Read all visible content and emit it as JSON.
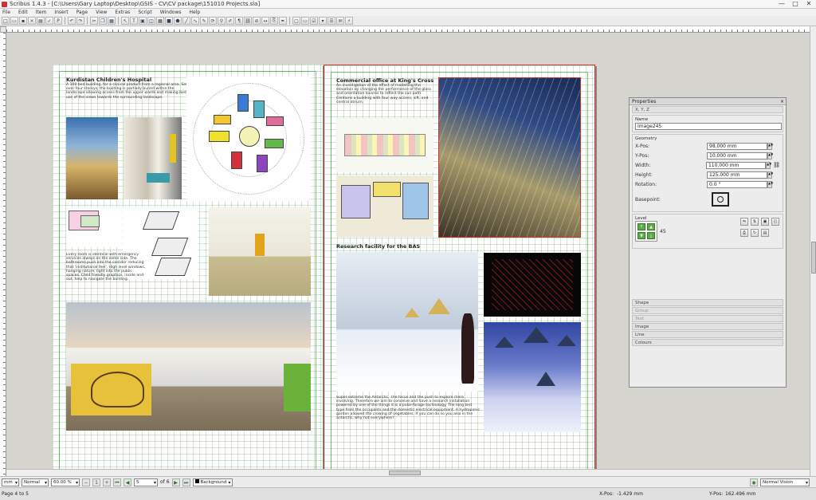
{
  "window": {
    "title": "Scribus 1.4.3 - [C:\\Users\\Gary Laptop\\Desktop\\GSIS - CV\\CV package\\151010 Projects.sla]",
    "buttons": [
      "—",
      "□",
      "✕"
    ]
  },
  "menu": [
    "File",
    "Edit",
    "Item",
    "Insert",
    "Page",
    "View",
    "Extras",
    "Script",
    "Windows",
    "Help"
  ],
  "page_left": {
    "project1": {
      "title": "Kurdistan Children's Hospital",
      "text": "A 100 bed building, for a clinical product from a regional area. Set over four storeys, the building is partially buried within the landscape allowing access from the upper wards and making best use of the views towards the surrounding landscape."
    },
    "project1_caption": "Every room is identical with emergency services always on the same side. The bathrooms push into the corridor reducing that 'institutional feel'. High level windows, hanging nature; light into the public spaces. Child friendly graphics, inside and out, help to navigate the building."
  },
  "page_right": {
    "project2": {
      "title": "Commercial office at King's Cross",
      "text": "An investigation of the effect of modelling the elevation by changing the performance of the glass and orientation louvres to reflect the sun path. Contains a building with four way access; sift, and central atrium."
    },
    "project3": {
      "title": "Research facility for the BAS",
      "text": "Super-extreme the Antarctic. The focus and the push to explore more involving. Therefore we aim to conceive and have a research installation powered by one of the things it is a polar-forage technology. The long test type from the occupants and the domestic electrical equipment. A hydroponic garden allowed the crowing of vegetables. If you can do so you also in the antarctic, why not everywhere?"
    }
  },
  "properties": {
    "panel_title": "Properties",
    "sections": {
      "xyz": "X, Y, Z",
      "name_label": "Name",
      "geometry": "Geometry",
      "level": "Level",
      "shape": "Shape",
      "group": "Group",
      "text": "Text",
      "image": "Image",
      "line": "Line",
      "colours": "Colours"
    },
    "name_value": "Image245",
    "fields": [
      {
        "label": "X-Pos:",
        "value": "98.000 mm"
      },
      {
        "label": "Y-Pos:",
        "value": "10.000 mm"
      },
      {
        "label": "Width:",
        "value": "110.000 mm"
      },
      {
        "label": "Height:",
        "value": "125.000 mm"
      },
      {
        "label": "Rotation:",
        "value": "0.0 °"
      }
    ],
    "basepoint_label": "Basepoint:",
    "level_value": "45"
  },
  "statusbar": {
    "unit": "mm",
    "mode": "Normal",
    "zoom": "60.00 %",
    "page_input": "5",
    "page_of": "of 6",
    "layer": "Background",
    "vision": "Normal Vision",
    "page_info": "Page 4 to 5",
    "xpos_label": "X-Pos:",
    "xpos_value": "-1.429 mm",
    "ypos_label": "Y-Pos:",
    "ypos_value": "162.496 mm"
  }
}
